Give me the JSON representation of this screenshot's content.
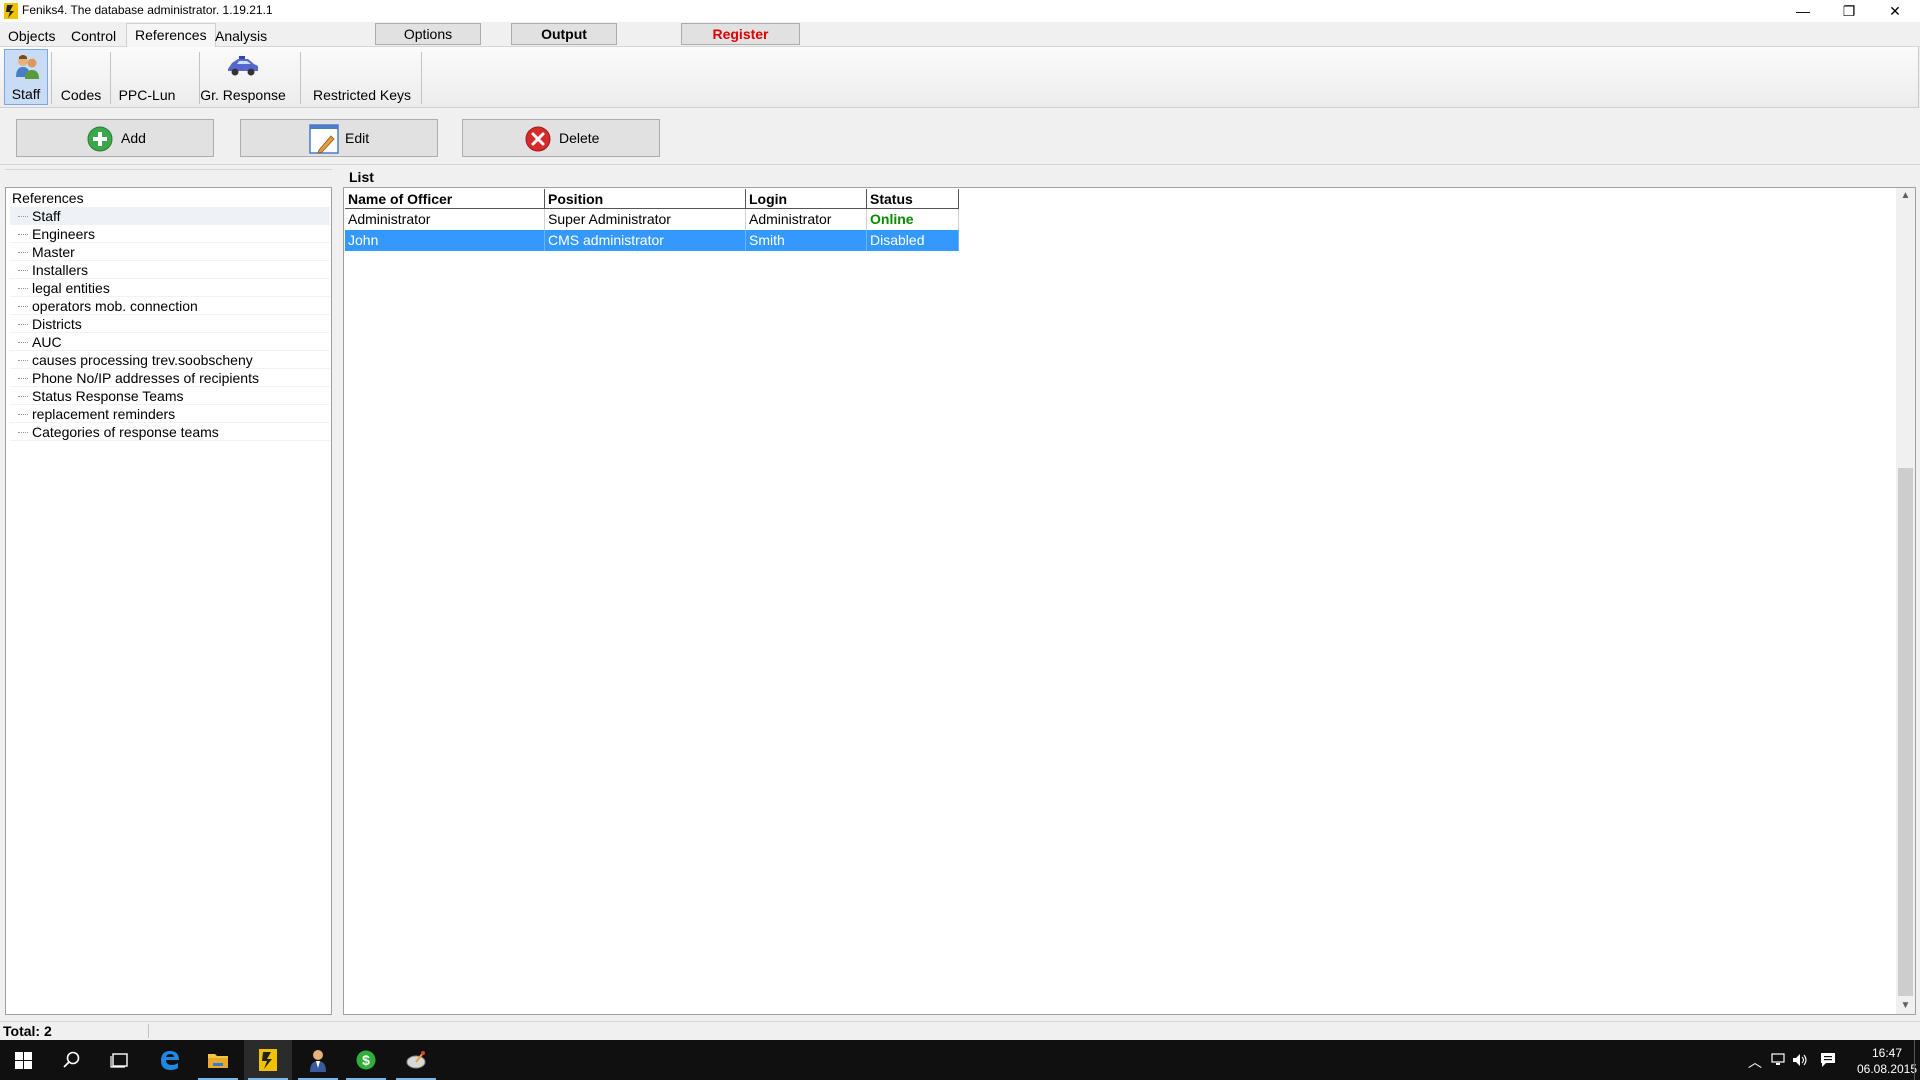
{
  "window": {
    "title": "Feniks4. The database administrator. 1.19.21.1",
    "controls": {
      "minimize": "—",
      "restore": "❐",
      "close": "✕"
    }
  },
  "menu_tabs": [
    {
      "label": "Objects",
      "active": false
    },
    {
      "label": "Control",
      "active": false
    },
    {
      "label": "References",
      "active": true
    },
    {
      "label": "Analysis",
      "active": false
    }
  ],
  "top_buttons": {
    "options": "Options",
    "output": "Output",
    "register": "Register"
  },
  "toolbar": [
    {
      "label": "Staff",
      "icon": "staff-icon",
      "selected": true
    },
    {
      "label": "Codes",
      "icon": "",
      "selected": false
    },
    {
      "label": "PPC-Lun",
      "icon": "",
      "selected": false
    },
    {
      "label": "Gr. Response",
      "icon": "car-icon",
      "selected": false
    },
    {
      "label": "Restricted Keys",
      "icon": "",
      "selected": false
    }
  ],
  "actions": {
    "add": {
      "label": "Add",
      "icon": "plus-circle-icon"
    },
    "edit": {
      "label": "Edit",
      "icon": "notepad-edit-icon"
    },
    "delete": {
      "label": "Delete",
      "icon": "x-circle-icon"
    }
  },
  "tree": {
    "root": "References",
    "items": [
      "Staff",
      "Engineers",
      "Master",
      "Installers",
      "legal entities",
      "operators mob. connection",
      "Districts",
      "AUC",
      "causes processing trev.soobscheny",
      "Phone No/IP addresses of recipients",
      "Status Response Teams",
      "replacement reminders",
      "Categories of response teams"
    ],
    "selected": "Staff"
  },
  "list": {
    "label": "List",
    "columns": [
      "Name of Officer",
      "Position",
      "Login",
      "Status"
    ],
    "rows": [
      {
        "name": "Administrator",
        "position": "Super Administrator",
        "login": "Administrator",
        "status": "Online",
        "selected": false
      },
      {
        "name": "John",
        "position": "CMS administrator",
        "login": "Smith",
        "status": "Disabled",
        "selected": true
      }
    ]
  },
  "status": {
    "total": "Total: 2"
  },
  "taskbar": {
    "clock_time": "16:47",
    "clock_date": "06.08.2015",
    "items": [
      "start-icon",
      "search-icon",
      "task-view-icon",
      "edge-icon",
      "file-explorer-icon",
      "feniks-icon",
      "user-app-icon",
      "green-dollar-icon",
      "satellite-icon"
    ]
  },
  "colors": {
    "selection": "#3399ff",
    "online": "#0b8a00",
    "register": "#e00000"
  }
}
